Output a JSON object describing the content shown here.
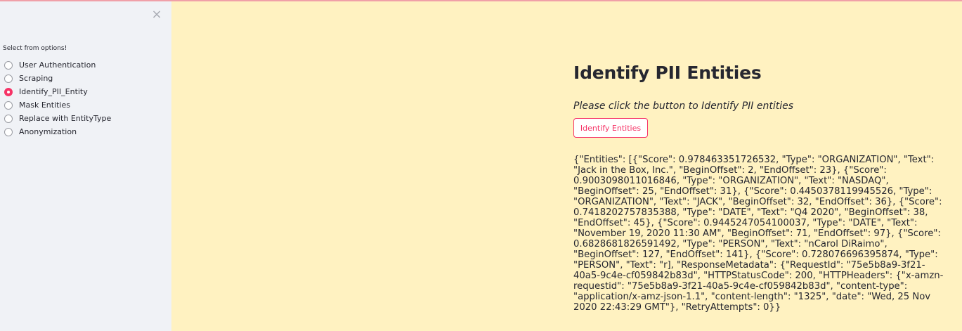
{
  "sidebar": {
    "close_icon": "×",
    "options_label": "Select from options!",
    "options": [
      {
        "label": "User Authentication",
        "selected": false
      },
      {
        "label": "Scraping",
        "selected": false
      },
      {
        "label": "Identify_PII_Entity",
        "selected": true
      },
      {
        "label": "Mask Entities",
        "selected": false
      },
      {
        "label": "Replace with EntityType",
        "selected": false
      },
      {
        "label": "Anonymization",
        "selected": false
      }
    ]
  },
  "main": {
    "title": "Identify PII Entities",
    "subtitle": "Please click the button to Identify PII entities",
    "button_label": "Identify Entities",
    "output": "{\"Entities\": [{\"Score\": 0.978463351726532, \"Type\": \"ORGANIZATION\", \"Text\": \"Jack in the Box, Inc.\", \"BeginOffset\": 2, \"EndOffset\": 23}, {\"Score\": 0.9003098011016846, \"Type\": \"ORGANIZATION\", \"Text\": \"NASDAQ\", \"BeginOffset\": 25, \"EndOffset\": 31}, {\"Score\": 0.4450378119945526, \"Type\": \"ORGANIZATION\", \"Text\": \"JACK\", \"BeginOffset\": 32, \"EndOffset\": 36}, {\"Score\": 0.7418202757835388, \"Type\": \"DATE\", \"Text\": \"Q4 2020\", \"BeginOffset\": 38, \"EndOffset\": 45}, {\"Score\": 0.9445247054100037, \"Type\": \"DATE\", \"Text\": \"November 19, 2020 11:30 AM\", \"BeginOffset\": 71, \"EndOffset\": 97}, {\"Score\": 0.6828681826591492, \"Type\": \"PERSON\", \"Text\": \"nCarol DiRaimo\", \"BeginOffset\": 127, \"EndOffset\": 141}, {\"Score\": 0.728076696395874, \"Type\": \"PERSON\", \"Text\": \"r], \"ResponseMetadata\": {\"RequestId\": \"75e5b8a9-3f21-40a5-9c4e-cf059842b83d\", \"HTTPStatusCode\": 200, \"HTTPHeaders\": {\"x-amzn-requestid\": \"75e5b8a9-3f21-40a5-9c4e-cf059842b83d\", \"content-type\": \"application/x-amz-json-1.1\", \"content-length\": \"1325\", \"date\": \"Wed, 25 Nov 2020 22:43:29 GMT\"}, \"RetryAttempts\": 0}}"
  },
  "colors": {
    "accent": "#f63366",
    "main_background": "#fff2c1",
    "sidebar_background": "#f0f2f6",
    "text": "#262730"
  }
}
